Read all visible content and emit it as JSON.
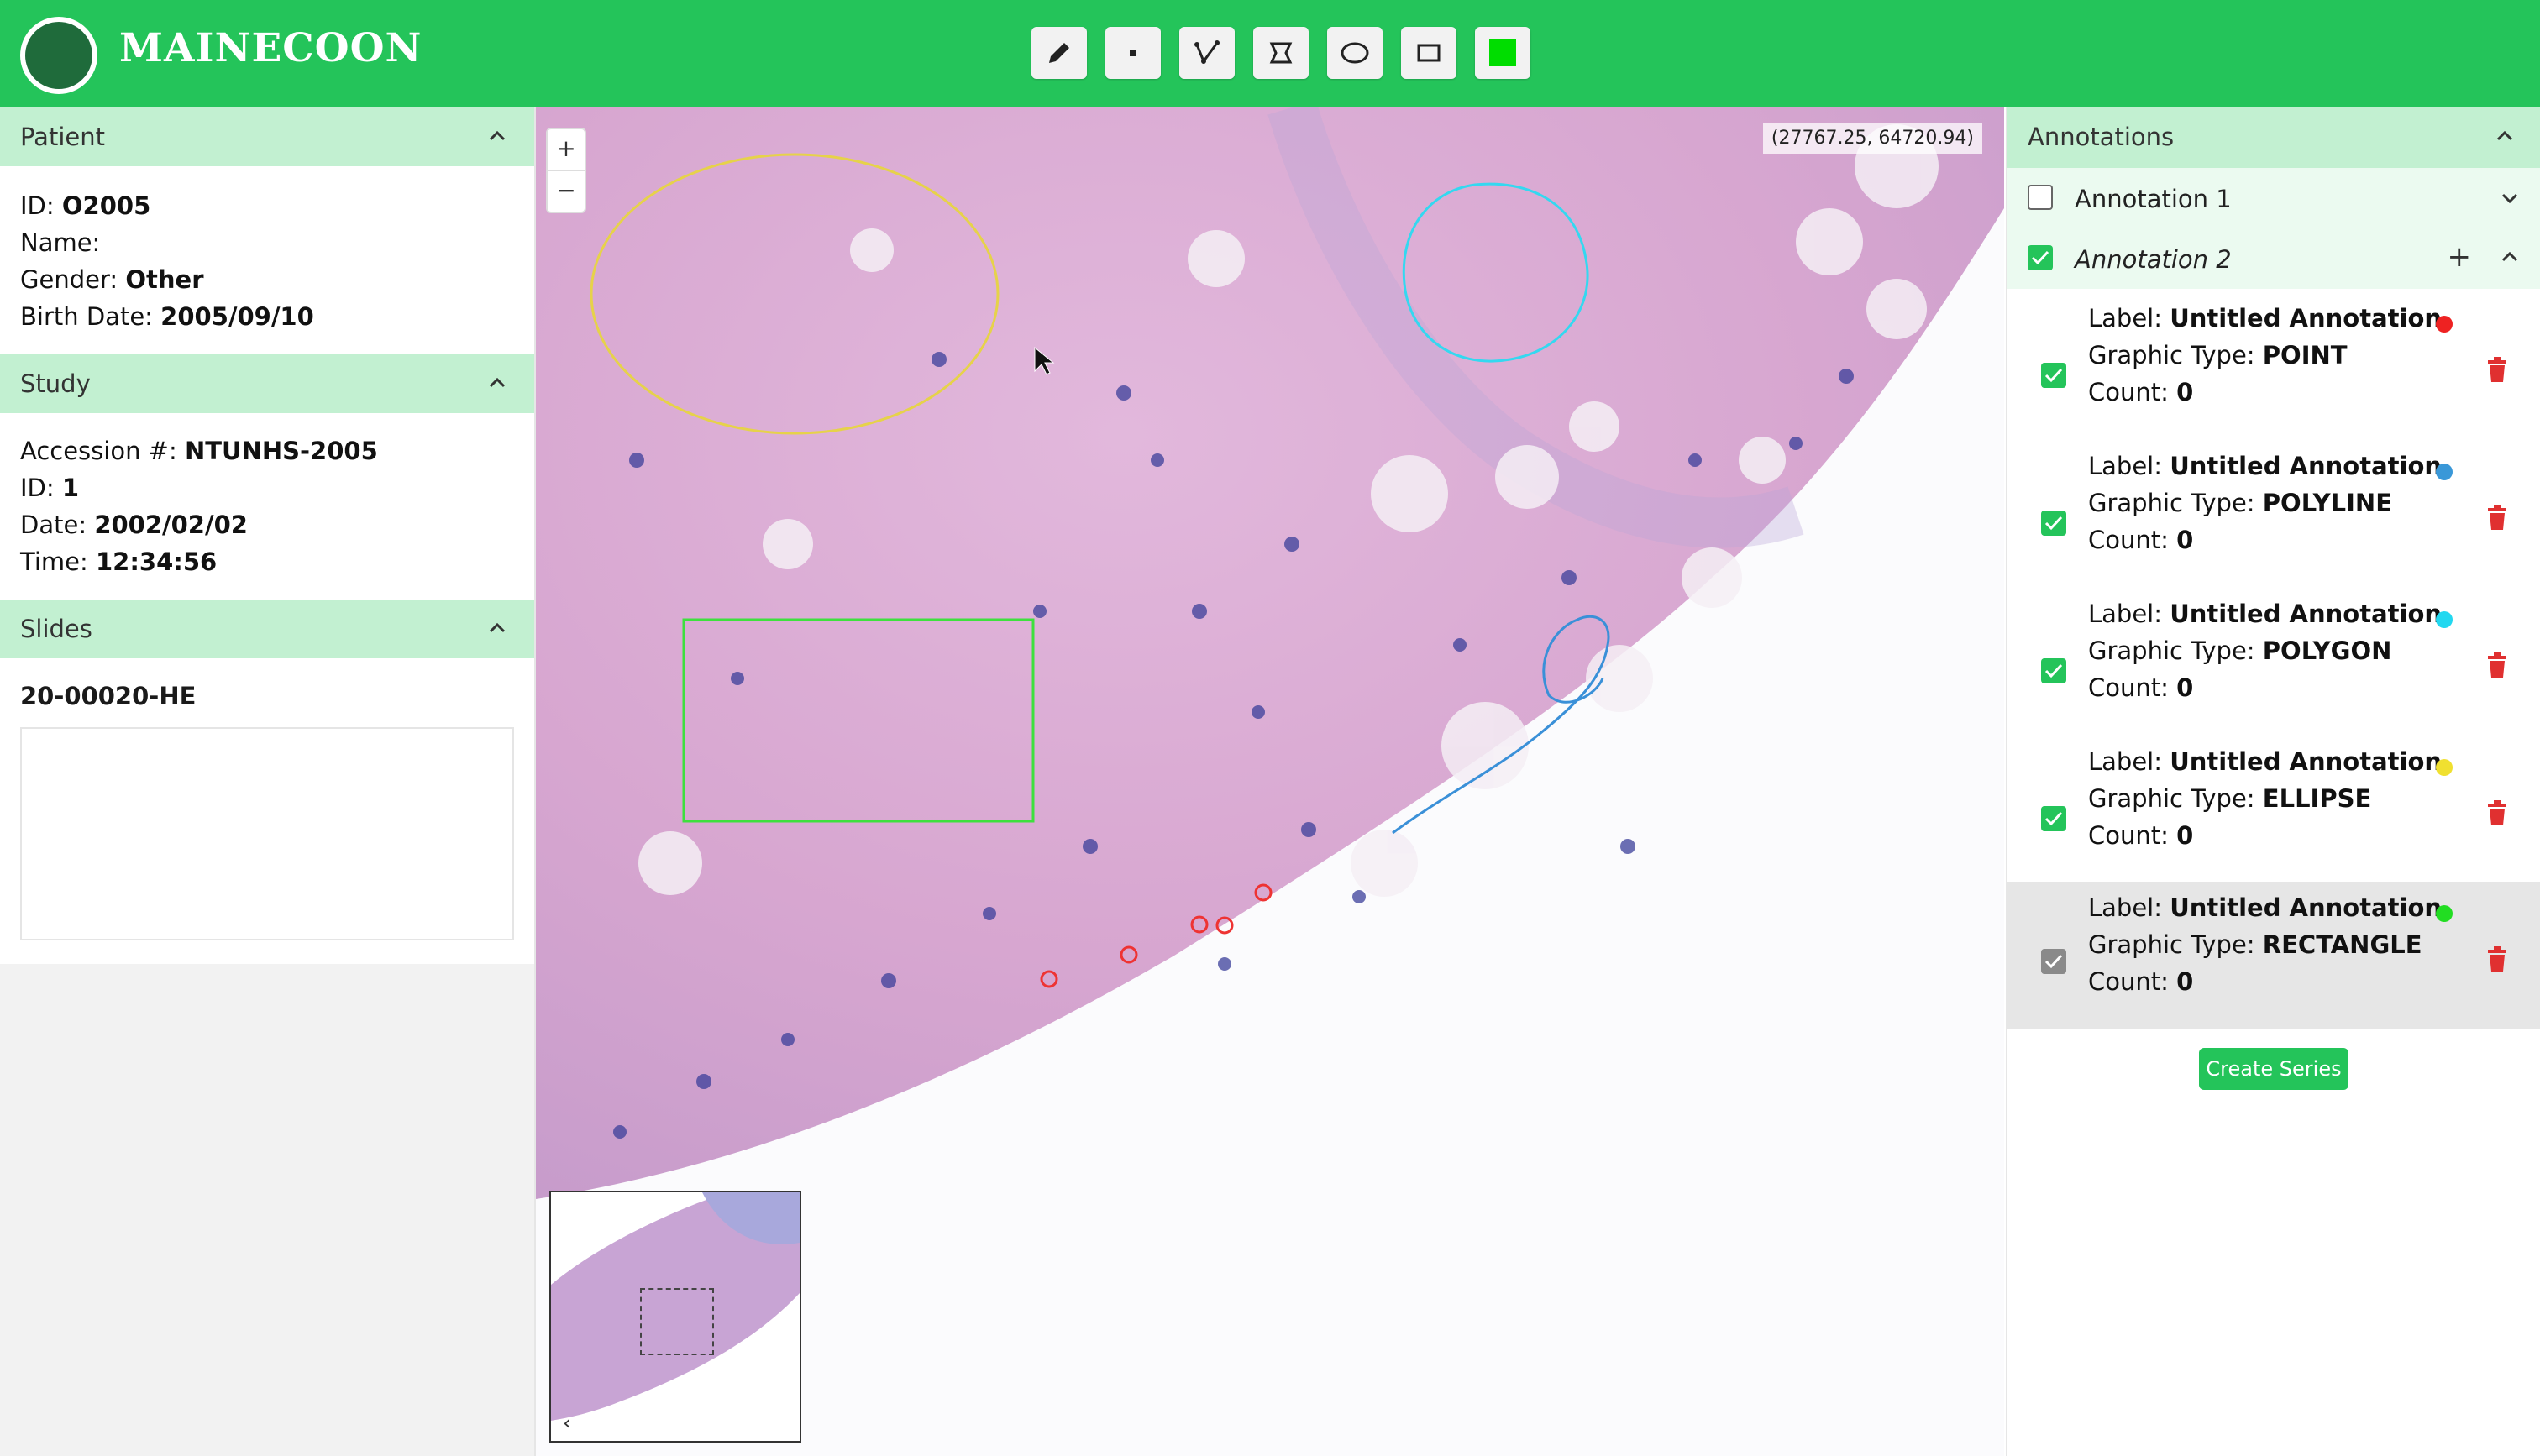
{
  "app": {
    "title": "MAINECOON"
  },
  "toolbar": {
    "tools": [
      "pen-tool",
      "point-tool",
      "polyline-tool",
      "polygon-tool",
      "ellipse-tool",
      "rectangle-tool",
      "color-swatch"
    ],
    "active_color": "#00dd00"
  },
  "patient": {
    "title": "Patient",
    "id_label": "ID:",
    "id_value": "O2005",
    "name_label": "Name:",
    "name_value": "",
    "gender_label": "Gender:",
    "gender_value": "Other",
    "birth_label": "Birth Date:",
    "birth_value": "2005/09/10"
  },
  "study": {
    "title": "Study",
    "accession_label": "Accession #:",
    "accession_value": "NTUNHS-2005",
    "id_label": "ID:",
    "id_value": "1",
    "date_label": "Date:",
    "date_value": "2002/02/02",
    "time_label": "Time:",
    "time_value": "12:34:56"
  },
  "slides": {
    "title": "Slides",
    "items": [
      "20-00020-HE"
    ]
  },
  "viewer": {
    "coords": "(27767.25, 64720.94)",
    "zoom_in": "+",
    "zoom_out": "−",
    "minimap_arrow": "‹"
  },
  "annotations": {
    "title": "Annotations",
    "groups": [
      {
        "name": "Annotation 1",
        "checked": false
      },
      {
        "name": "Annotation 2",
        "checked": true,
        "add": "+"
      }
    ],
    "items": [
      {
        "label_key": "Label:",
        "label": "Untitled Annotation",
        "type_key": "Graphic Type:",
        "type": "POINT",
        "count_key": "Count:",
        "count": "0",
        "color": "#ee2222"
      },
      {
        "label_key": "Label:",
        "label": "Untitled Annotation",
        "type_key": "Graphic Type:",
        "type": "POLYLINE",
        "count_key": "Count:",
        "count": "0",
        "color": "#3a98d8"
      },
      {
        "label_key": "Label:",
        "label": "Untitled Annotation",
        "type_key": "Graphic Type:",
        "type": "POLYGON",
        "count_key": "Count:",
        "count": "0",
        "color": "#22d8f0"
      },
      {
        "label_key": "Label:",
        "label": "Untitled Annotation",
        "type_key": "Graphic Type:",
        "type": "ELLIPSE",
        "count_key": "Count:",
        "count": "0",
        "color": "#f0e030"
      },
      {
        "label_key": "Label:",
        "label": "Untitled Annotation",
        "type_key": "Graphic Type:",
        "type": "RECTANGLE",
        "count_key": "Count:",
        "count": "0",
        "color": "#22dd22"
      }
    ],
    "create_button": "Create Series"
  },
  "colors": {
    "brand": "#24c45a",
    "section_header": "#c2f0d1",
    "delete": "#e03030"
  }
}
